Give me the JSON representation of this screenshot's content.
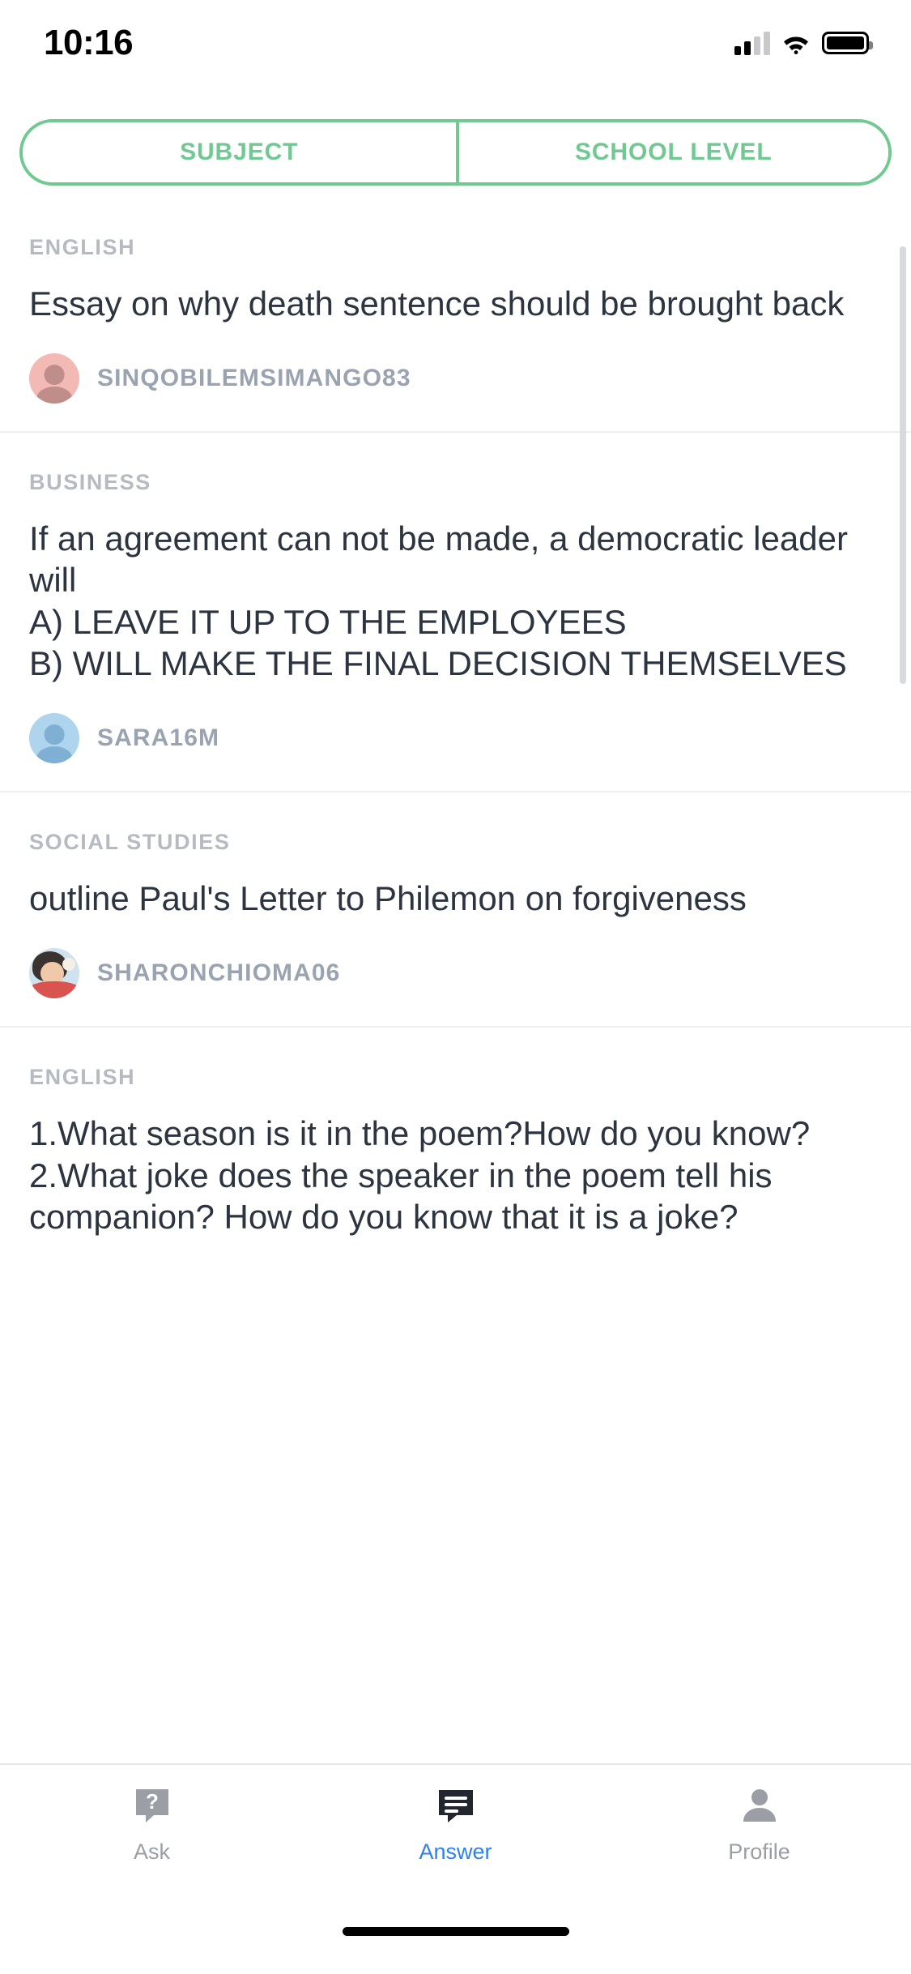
{
  "status_bar": {
    "time": "10:16",
    "cellular_icon": "cellular-signal-icon",
    "wifi_icon": "wifi-icon",
    "battery_icon": "battery-full-icon"
  },
  "segmented_control": {
    "tabs": [
      {
        "label": "SUBJECT",
        "selected": true
      },
      {
        "label": "SCHOOL LEVEL",
        "selected": false
      }
    ],
    "accent_color": "#6fc990"
  },
  "questions": [
    {
      "subject": "ENGLISH",
      "title": "Essay on why death sentence should be brought back",
      "paragraphs": [],
      "author": "SINQOBILEMSIMANGO83",
      "avatar_type": "person-silhouette",
      "avatar_bg": "#f2b9b5",
      "avatar_fg": "#c08e8a"
    },
    {
      "subject": "BUSINESS",
      "title": "If an agreement can not be made, a democratic leader will",
      "paragraphs": [
        "A) LEAVE IT UP TO THE EMPLOYEES",
        "B) WILL MAKE THE FINAL DECISION THEMSELVES"
      ],
      "author": "SARA16M",
      "avatar_type": "person-silhouette",
      "avatar_bg": "#aed4ee",
      "avatar_fg": "#7fb0d4"
    },
    {
      "subject": "SOCIAL STUDIES",
      "title": "outline Paul's Letter to Philemon on forgiveness",
      "paragraphs": [],
      "author": "SHARONCHIOMA06",
      "avatar_type": "profile-photo",
      "avatar_bg": "#d9534f",
      "avatar_fg": "#f0c9a8"
    },
    {
      "subject": "ENGLISH",
      "title": "1.What season is it in the poem?How do you know?",
      "paragraphs": [
        "2.What joke does the speaker in the poem tell his companion? How do you know that it is a joke?"
      ],
      "author": "",
      "avatar_type": "",
      "avatar_bg": "",
      "avatar_fg": ""
    }
  ],
  "tab_bar": {
    "items": [
      {
        "label": "Ask",
        "icon": "question-bubble-icon",
        "active": false
      },
      {
        "label": "Answer",
        "icon": "answer-chat-icon",
        "active": true
      },
      {
        "label": "Profile",
        "icon": "person-icon",
        "active": false
      }
    ],
    "active_color": "#2f80ed",
    "inactive_color": "#9b9ea4"
  }
}
